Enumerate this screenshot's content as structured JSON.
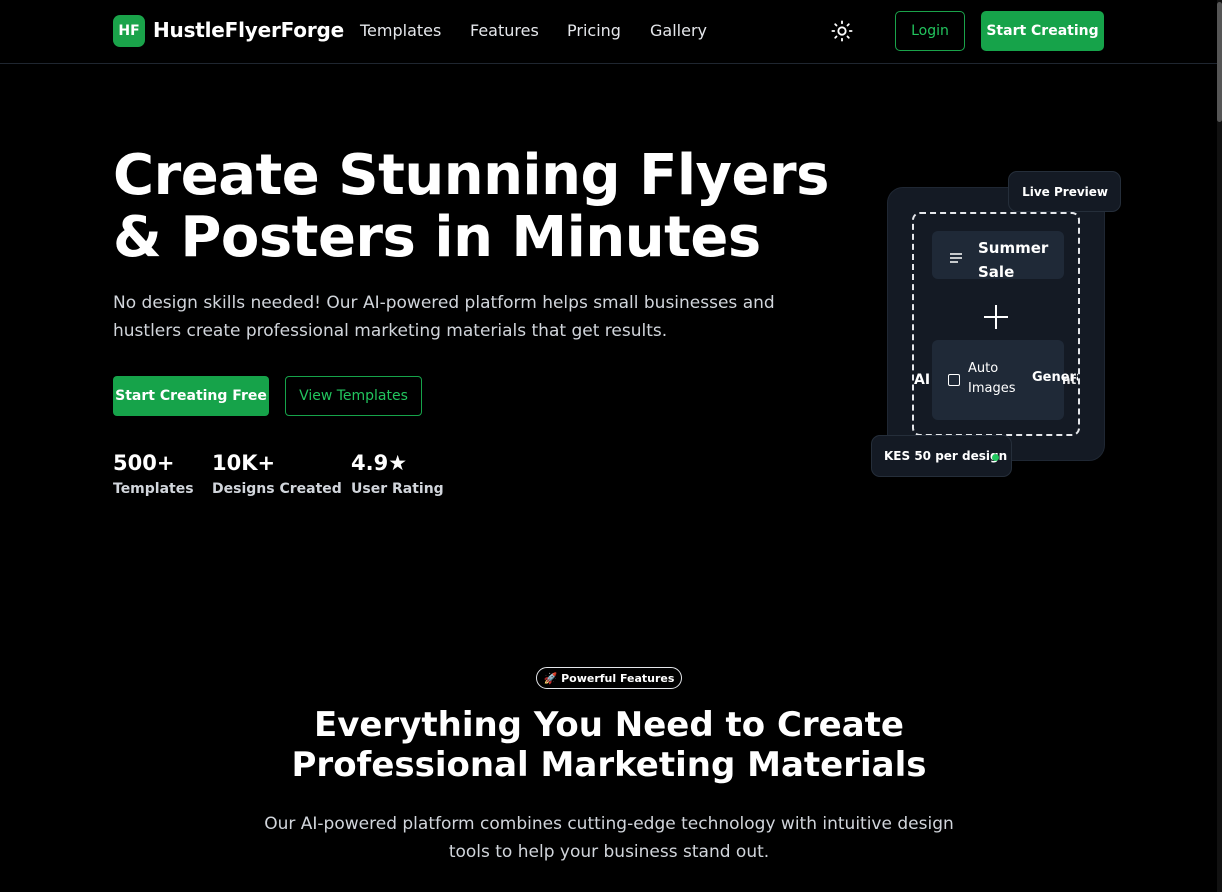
{
  "nav": {
    "logo_badge": "HF",
    "brand": "HustleFlyerForge",
    "links": [
      "Templates",
      "Features",
      "Pricing",
      "Gallery"
    ],
    "theme_icon": "sun-icon",
    "login": "Login",
    "start": "Start Creating"
  },
  "hero": {
    "title": "Create Stunning Flyers & Posters in Minutes",
    "subtitle": "No design skills needed! Our AI-powered platform helps small businesses and hustlers create professional marketing materials that get results.",
    "cta_primary": "Start Creating Free",
    "cta_secondary": "View Templates",
    "stats": [
      {
        "value": "500+",
        "label": "Templates"
      },
      {
        "value": "10K+",
        "label": "Designs Created"
      },
      {
        "value": "4.9★",
        "label": "User Rating"
      }
    ]
  },
  "preview": {
    "live_badge": "Live Preview",
    "tile1": "Summer Sale",
    "tile1_icon": "text-lines-icon",
    "tile2": "Auto Images",
    "tile2_icon": "image-icon",
    "left_clipped": "AI",
    "right_clipped": "Genera",
    "right_clipped_overlap": "nt",
    "price_badge": "KES 50 per design"
  },
  "features": {
    "pill": "🚀 Powerful Features",
    "title": "Everything You Need to Create Professional Marketing Materials",
    "subtitle": "Our AI-powered platform combines cutting-edge technology with intuitive design tools to help your business stand out."
  },
  "colors": {
    "accent": "#16a34a",
    "background": "#000000",
    "card": "#141a24"
  }
}
